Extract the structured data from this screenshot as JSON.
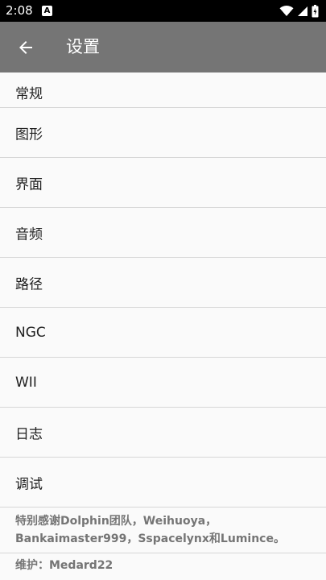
{
  "status_bar": {
    "time": "2:08",
    "notification_icon": "A"
  },
  "app_bar": {
    "title": "设置"
  },
  "settings": {
    "items": [
      {
        "label": "常规"
      },
      {
        "label": "图形"
      },
      {
        "label": "界面"
      },
      {
        "label": "音频"
      },
      {
        "label": "路径"
      },
      {
        "label": "NGC"
      },
      {
        "label": "WII"
      },
      {
        "label": "日志"
      },
      {
        "label": "调试"
      }
    ]
  },
  "credits": {
    "thanks": "特别感谢Dolphin团队，Weihuoya，Bankaimaster999，Sspacelynx和Lumince。",
    "maintainer": "维护：Medard22"
  },
  "colors": {
    "app_bar": "#757575",
    "background": "#fafafa",
    "divider": "#d6d6d6"
  }
}
